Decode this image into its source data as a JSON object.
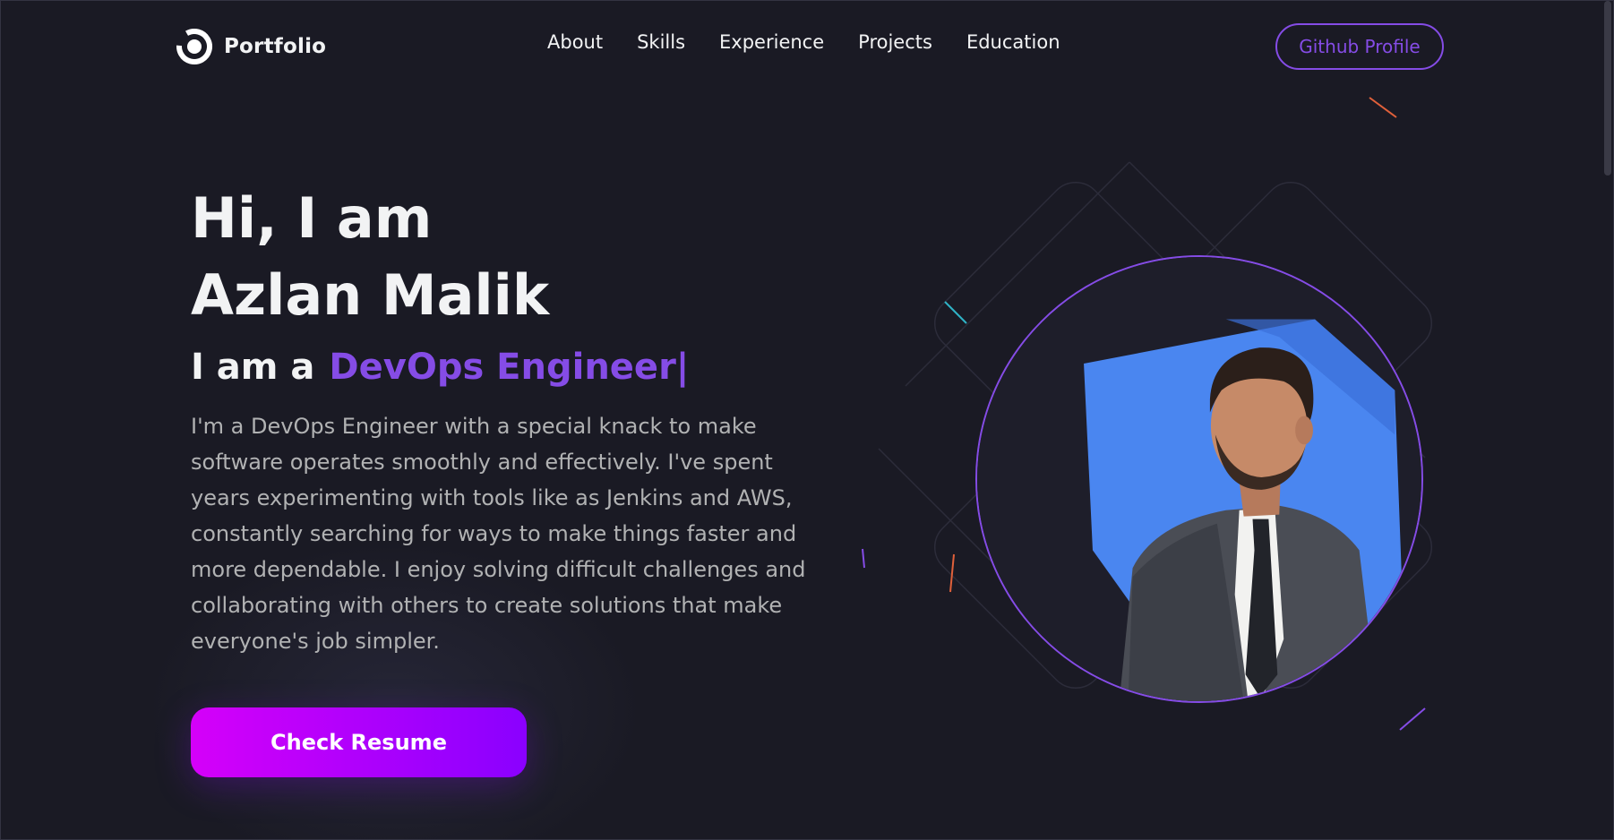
{
  "nav": {
    "logo_text": "Portfolio",
    "menu": [
      {
        "label": "About"
      },
      {
        "label": "Skills"
      },
      {
        "label": "Experience"
      },
      {
        "label": "Projects"
      },
      {
        "label": "Education"
      }
    ],
    "github_label": "Github Profile"
  },
  "hero": {
    "line1": "Hi, I am",
    "line2": "Azlan Malik",
    "role_prefix": "I am a",
    "role_text": "DevOps Engineer",
    "caret": "|",
    "description": "I'm a DevOps Engineer with a special knack to make software operates smoothly and effectively. I've spent years experimenting with tools like as Jenkins and AWS, constantly searching for ways to make things faster and more dependable. I enjoy solving difficult challenges and collaborating with others to create solutions that make everyone's job simpler.",
    "resume_label": "Check Resume"
  },
  "colors": {
    "background": "#1a1a24",
    "accent": "#854ce6",
    "text": "#f2f3f4",
    "muted": "#b1b2b3",
    "button_start": "#d500f9",
    "button_end": "#8a00ff",
    "photo_bg": "#4a86f0"
  },
  "icons": {
    "logo": "portfolio-logo-icon"
  }
}
